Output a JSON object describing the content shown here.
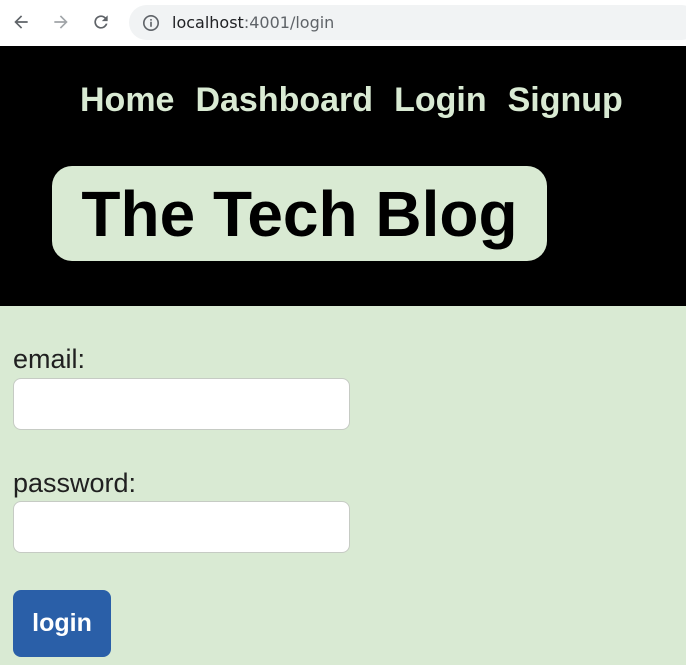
{
  "browser": {
    "url_host": "localhost",
    "url_path": ":4001/login",
    "icons": {
      "back": "arrow-left-icon",
      "forward": "arrow-right-icon",
      "reload": "reload-icon",
      "site_info": "info-icon"
    }
  },
  "nav": {
    "items": [
      {
        "label": "Home"
      },
      {
        "label": "Dashboard"
      },
      {
        "label": "Login"
      },
      {
        "label": "Signup"
      }
    ]
  },
  "header": {
    "title": "The Tech Blog"
  },
  "login_form": {
    "email_label": "email:",
    "email_value": "",
    "password_label": "password:",
    "password_value": "",
    "submit_label": "login"
  },
  "colors": {
    "page_background": "#d9ead3",
    "header_background": "#000000",
    "nav_text": "#d9ead3",
    "button_background": "#2a5fa8",
    "button_text": "#ffffff"
  }
}
